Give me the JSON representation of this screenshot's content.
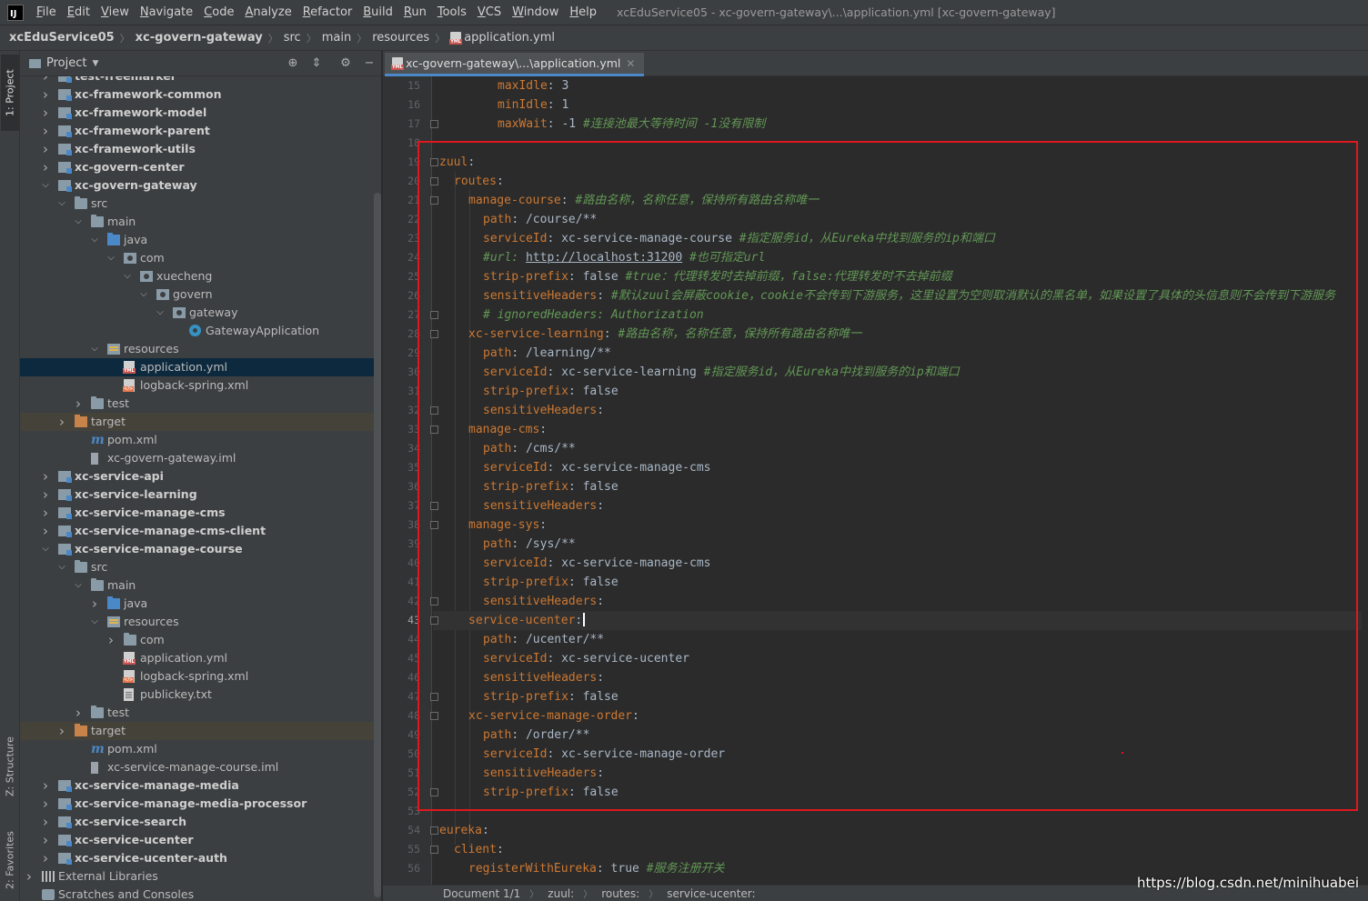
{
  "menu": {
    "logo": "IJ",
    "items": [
      "File",
      "Edit",
      "View",
      "Navigate",
      "Code",
      "Analyze",
      "Refactor",
      "Build",
      "Run",
      "Tools",
      "VCS",
      "Window",
      "Help"
    ],
    "window_title": "xcEduService05 - xc-govern-gateway\\...\\application.yml [xc-govern-gateway]"
  },
  "breadcrumb": [
    "xcEduService05",
    "xc-govern-gateway",
    "src",
    "main",
    "resources",
    "application.yml"
  ],
  "toolstrip": {
    "project": "1: Project",
    "structure": "Z: Structure",
    "favorites": "2: Favorites"
  },
  "project_panel": {
    "title": "Project",
    "tree": [
      {
        "indent": 0,
        "arrow": "right",
        "icon": "module",
        "label": "test-freemarker",
        "bold": true
      },
      {
        "indent": 0,
        "arrow": "right",
        "icon": "module",
        "label": "xc-framework-common",
        "bold": true
      },
      {
        "indent": 0,
        "arrow": "right",
        "icon": "module",
        "label": "xc-framework-model",
        "bold": true
      },
      {
        "indent": 0,
        "arrow": "right",
        "icon": "module",
        "label": "xc-framework-parent",
        "bold": true
      },
      {
        "indent": 0,
        "arrow": "right",
        "icon": "module",
        "label": "xc-framework-utils",
        "bold": true
      },
      {
        "indent": 0,
        "arrow": "right",
        "icon": "module",
        "label": "xc-govern-center",
        "bold": true
      },
      {
        "indent": 0,
        "arrow": "down",
        "icon": "module",
        "label": "xc-govern-gateway",
        "bold": true
      },
      {
        "indent": 1,
        "arrow": "down",
        "icon": "folder",
        "label": "src"
      },
      {
        "indent": 2,
        "arrow": "down",
        "icon": "folder",
        "label": "main"
      },
      {
        "indent": 3,
        "arrow": "down",
        "icon": "src",
        "label": "java"
      },
      {
        "indent": 4,
        "arrow": "down",
        "icon": "pkg",
        "label": "com"
      },
      {
        "indent": 5,
        "arrow": "down",
        "icon": "pkg",
        "label": "xuecheng"
      },
      {
        "indent": 6,
        "arrow": "down",
        "icon": "pkg",
        "label": "govern"
      },
      {
        "indent": 7,
        "arrow": "down",
        "icon": "pkg",
        "label": "gateway"
      },
      {
        "indent": 8,
        "arrow": "",
        "icon": "java-class",
        "label": "GatewayApplication"
      },
      {
        "indent": 3,
        "arrow": "down",
        "icon": "res",
        "label": "resources"
      },
      {
        "indent": 4,
        "arrow": "",
        "icon": "yml",
        "label": "application.yml",
        "selected": true
      },
      {
        "indent": 4,
        "arrow": "",
        "icon": "xml",
        "label": "logback-spring.xml"
      },
      {
        "indent": 2,
        "arrow": "right",
        "icon": "folder",
        "label": "test"
      },
      {
        "indent": 1,
        "arrow": "right",
        "icon": "target",
        "label": "target",
        "excluded": true
      },
      {
        "indent": 2,
        "arrow": "",
        "icon": "maven",
        "label": "pom.xml"
      },
      {
        "indent": 2,
        "arrow": "",
        "icon": "iml",
        "label": "xc-govern-gateway.iml"
      },
      {
        "indent": 0,
        "arrow": "right",
        "icon": "module",
        "label": "xc-service-api",
        "bold": true
      },
      {
        "indent": 0,
        "arrow": "right",
        "icon": "module",
        "label": "xc-service-learning",
        "bold": true
      },
      {
        "indent": 0,
        "arrow": "right",
        "icon": "module",
        "label": "xc-service-manage-cms",
        "bold": true
      },
      {
        "indent": 0,
        "arrow": "right",
        "icon": "module",
        "label": "xc-service-manage-cms-client",
        "bold": true
      },
      {
        "indent": 0,
        "arrow": "down",
        "icon": "module",
        "label": "xc-service-manage-course",
        "bold": true
      },
      {
        "indent": 1,
        "arrow": "down",
        "icon": "folder",
        "label": "src"
      },
      {
        "indent": 2,
        "arrow": "down",
        "icon": "folder",
        "label": "main"
      },
      {
        "indent": 3,
        "arrow": "right",
        "icon": "src",
        "label": "java"
      },
      {
        "indent": 3,
        "arrow": "down",
        "icon": "res",
        "label": "resources"
      },
      {
        "indent": 4,
        "arrow": "right",
        "icon": "folder",
        "label": "com"
      },
      {
        "indent": 4,
        "arrow": "",
        "icon": "yml",
        "label": "application.yml"
      },
      {
        "indent": 4,
        "arrow": "",
        "icon": "xml",
        "label": "logback-spring.xml"
      },
      {
        "indent": 4,
        "arrow": "",
        "icon": "txt",
        "label": "publickey.txt"
      },
      {
        "indent": 2,
        "arrow": "right",
        "icon": "folder",
        "label": "test"
      },
      {
        "indent": 1,
        "arrow": "right",
        "icon": "target",
        "label": "target",
        "excluded": true
      },
      {
        "indent": 2,
        "arrow": "",
        "icon": "maven",
        "label": "pom.xml"
      },
      {
        "indent": 2,
        "arrow": "",
        "icon": "iml",
        "label": "xc-service-manage-course.iml"
      },
      {
        "indent": 0,
        "arrow": "right",
        "icon": "module",
        "label": "xc-service-manage-media",
        "bold": true
      },
      {
        "indent": 0,
        "arrow": "right",
        "icon": "module",
        "label": "xc-service-manage-media-processor",
        "bold": true
      },
      {
        "indent": 0,
        "arrow": "right",
        "icon": "module",
        "label": "xc-service-search",
        "bold": true
      },
      {
        "indent": 0,
        "arrow": "right",
        "icon": "module",
        "label": "xc-service-ucenter",
        "bold": true
      },
      {
        "indent": 0,
        "arrow": "right",
        "icon": "module",
        "label": "xc-service-ucenter-auth",
        "bold": true
      },
      {
        "indent": -1,
        "arrow": "right",
        "icon": "lib",
        "label": "External Libraries"
      },
      {
        "indent": -1,
        "arrow": "",
        "icon": "scratch",
        "label": "Scratches and Consoles"
      }
    ]
  },
  "editor": {
    "tab_label": "xc-govern-gateway\\...\\application.yml",
    "current_line": 43,
    "lines": [
      {
        "n": 15,
        "ind": 4,
        "parts": [
          [
            "k",
            "maxIdle"
          ],
          [
            "v",
            ": 3"
          ]
        ]
      },
      {
        "n": 16,
        "ind": 4,
        "parts": [
          [
            "k",
            "minIdle"
          ],
          [
            "v",
            ": 1"
          ]
        ]
      },
      {
        "n": 17,
        "ind": 4,
        "parts": [
          [
            "k",
            "maxWait"
          ],
          [
            "v",
            ": -1 "
          ],
          [
            "c",
            "#连接池最大等待时间 -1没有限制"
          ]
        ],
        "fold": true
      },
      {
        "n": 18,
        "ind": 0,
        "parts": []
      },
      {
        "n": 19,
        "ind": 0,
        "parts": [
          [
            "k",
            "zuul"
          ],
          [
            "v",
            ":"
          ]
        ],
        "fold": true
      },
      {
        "n": 20,
        "ind": 1,
        "parts": [
          [
            "k",
            "routes"
          ],
          [
            "v",
            ":"
          ]
        ],
        "fold": true
      },
      {
        "n": 21,
        "ind": 2,
        "parts": [
          [
            "k",
            "manage-course"
          ],
          [
            "v",
            ": "
          ],
          [
            "c",
            "#路由名称，名称任意，保持所有路由名称唯一"
          ]
        ],
        "fold": true
      },
      {
        "n": 22,
        "ind": 3,
        "parts": [
          [
            "k",
            "path"
          ],
          [
            "v",
            ": /course/**"
          ]
        ]
      },
      {
        "n": 23,
        "ind": 3,
        "parts": [
          [
            "k",
            "serviceId"
          ],
          [
            "v",
            ": xc-service-manage-course "
          ],
          [
            "c",
            "#指定服务id，从Eureka中找到服务的ip和端口"
          ]
        ]
      },
      {
        "n": 24,
        "ind": 3,
        "parts": [
          [
            "c",
            "#url: "
          ],
          [
            "u",
            "http://localhost:31200"
          ],
          [
            "c",
            " #也可指定url"
          ]
        ]
      },
      {
        "n": 25,
        "ind": 3,
        "parts": [
          [
            "k",
            "strip-prefix"
          ],
          [
            "v",
            ": false "
          ],
          [
            "c",
            "#true：代理转发时去掉前缀，false:代理转发时不去掉前缀"
          ]
        ]
      },
      {
        "n": 26,
        "ind": 3,
        "parts": [
          [
            "k",
            "sensitiveHeaders"
          ],
          [
            "v",
            ": "
          ],
          [
            "c",
            "#默认zuul会屏蔽cookie，cookie不会传到下游服务，这里设置为空则取消默认的黑名单，如果设置了具体的头信息则不会传到下游服务"
          ]
        ]
      },
      {
        "n": 27,
        "ind": 3,
        "parts": [
          [
            "c",
            "# ignoredHeaders: Authorization"
          ]
        ],
        "fold": true
      },
      {
        "n": 28,
        "ind": 2,
        "parts": [
          [
            "k",
            "xc-service-learning"
          ],
          [
            "v",
            ": "
          ],
          [
            "c",
            "#路由名称，名称任意，保持所有路由名称唯一"
          ]
        ],
        "fold": true
      },
      {
        "n": 29,
        "ind": 3,
        "parts": [
          [
            "k",
            "path"
          ],
          [
            "v",
            ": /learning/**"
          ]
        ]
      },
      {
        "n": 30,
        "ind": 3,
        "parts": [
          [
            "k",
            "serviceId"
          ],
          [
            "v",
            ": xc-service-learning "
          ],
          [
            "c",
            "#指定服务id，从Eureka中找到服务的ip和端口"
          ]
        ]
      },
      {
        "n": 31,
        "ind": 3,
        "parts": [
          [
            "k",
            "strip-prefix"
          ],
          [
            "v",
            ": false"
          ]
        ]
      },
      {
        "n": 32,
        "ind": 3,
        "parts": [
          [
            "k",
            "sensitiveHeaders"
          ],
          [
            "v",
            ":"
          ]
        ],
        "fold": true
      },
      {
        "n": 33,
        "ind": 2,
        "parts": [
          [
            "k",
            "manage-cms"
          ],
          [
            "v",
            ":"
          ]
        ],
        "fold": true
      },
      {
        "n": 34,
        "ind": 3,
        "parts": [
          [
            "k",
            "path"
          ],
          [
            "v",
            ": /cms/**"
          ]
        ]
      },
      {
        "n": 35,
        "ind": 3,
        "parts": [
          [
            "k",
            "serviceId"
          ],
          [
            "v",
            ": xc-service-manage-cms"
          ]
        ]
      },
      {
        "n": 36,
        "ind": 3,
        "parts": [
          [
            "k",
            "strip-prefix"
          ],
          [
            "v",
            ": false"
          ]
        ]
      },
      {
        "n": 37,
        "ind": 3,
        "parts": [
          [
            "k",
            "sensitiveHeaders"
          ],
          [
            "v",
            ":"
          ]
        ],
        "fold": true
      },
      {
        "n": 38,
        "ind": 2,
        "parts": [
          [
            "k",
            "manage-sys"
          ],
          [
            "v",
            ":"
          ]
        ],
        "fold": true
      },
      {
        "n": 39,
        "ind": 3,
        "parts": [
          [
            "k",
            "path"
          ],
          [
            "v",
            ": /sys/**"
          ]
        ]
      },
      {
        "n": 40,
        "ind": 3,
        "parts": [
          [
            "k",
            "serviceId"
          ],
          [
            "v",
            ": xc-service-manage-cms"
          ]
        ]
      },
      {
        "n": 41,
        "ind": 3,
        "parts": [
          [
            "k",
            "strip-prefix"
          ],
          [
            "v",
            ": false"
          ]
        ]
      },
      {
        "n": 42,
        "ind": 3,
        "parts": [
          [
            "k",
            "sensitiveHeaders"
          ],
          [
            "v",
            ":"
          ]
        ],
        "fold": true
      },
      {
        "n": 43,
        "ind": 2,
        "parts": [
          [
            "k",
            "service-ucenter"
          ],
          [
            "v",
            ":"
          ]
        ],
        "fold": true,
        "caret": true
      },
      {
        "n": 44,
        "ind": 3,
        "parts": [
          [
            "k",
            "path"
          ],
          [
            "v",
            ": /ucenter/**"
          ]
        ]
      },
      {
        "n": 45,
        "ind": 3,
        "parts": [
          [
            "k",
            "serviceId"
          ],
          [
            "v",
            ": xc-service-ucenter"
          ]
        ]
      },
      {
        "n": 46,
        "ind": 3,
        "parts": [
          [
            "k",
            "sensitiveHeaders"
          ],
          [
            "v",
            ":"
          ]
        ]
      },
      {
        "n": 47,
        "ind": 3,
        "parts": [
          [
            "k",
            "strip-prefix"
          ],
          [
            "v",
            ": false"
          ]
        ],
        "fold": true
      },
      {
        "n": 48,
        "ind": 2,
        "parts": [
          [
            "k",
            "xc-service-manage-order"
          ],
          [
            "v",
            ":"
          ]
        ],
        "fold": true
      },
      {
        "n": 49,
        "ind": 3,
        "parts": [
          [
            "k",
            "path"
          ],
          [
            "v",
            ": /order/**"
          ]
        ]
      },
      {
        "n": 50,
        "ind": 3,
        "parts": [
          [
            "k",
            "serviceId"
          ],
          [
            "v",
            ": xc-service-manage-order"
          ]
        ]
      },
      {
        "n": 51,
        "ind": 3,
        "parts": [
          [
            "k",
            "sensitiveHeaders"
          ],
          [
            "v",
            ":"
          ]
        ]
      },
      {
        "n": 52,
        "ind": 3,
        "parts": [
          [
            "k",
            "strip-prefix"
          ],
          [
            "v",
            ": false"
          ]
        ],
        "fold": true
      },
      {
        "n": 53,
        "ind": 0,
        "parts": []
      },
      {
        "n": 54,
        "ind": 0,
        "parts": [
          [
            "k",
            "eureka"
          ],
          [
            "v",
            ":"
          ]
        ],
        "fold": true
      },
      {
        "n": 55,
        "ind": 1,
        "parts": [
          [
            "k",
            "client"
          ],
          [
            "v",
            ":"
          ]
        ],
        "fold": true
      },
      {
        "n": 56,
        "ind": 2,
        "parts": [
          [
            "k",
            "registerWithEureka"
          ],
          [
            "v",
            ": true "
          ],
          [
            "c",
            "#服务注册开关"
          ]
        ]
      }
    ]
  },
  "statusbar": [
    "Document 1/1",
    "zuul:",
    "routes:",
    "service-ucenter:"
  ],
  "watermark": "https://blog.csdn.net/minihuabei",
  "colors": {
    "highlight_box": "#e0181e",
    "key": "#cc7832",
    "comment": "#629755",
    "selection": "#0d293e"
  }
}
